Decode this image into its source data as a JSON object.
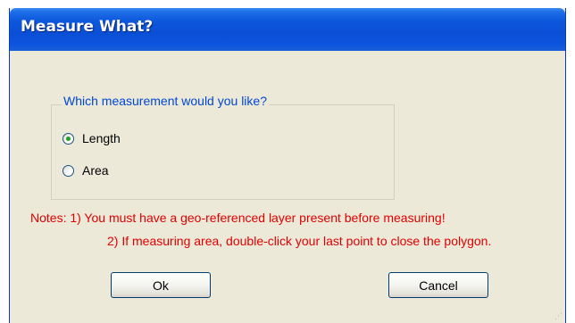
{
  "dialog": {
    "title": "Measure What?"
  },
  "group": {
    "legend": "Which measurement would you like?",
    "options": [
      {
        "label": "Length",
        "checked": true
      },
      {
        "label": "Area",
        "checked": false
      }
    ]
  },
  "notes": {
    "line1": "Notes: 1) You must have a geo-referenced layer present before measuring!",
    "line2": "2) If measuring area, double-click your last point to close the polygon."
  },
  "buttons": {
    "ok_label": "Ok",
    "cancel_label": "Cancel"
  },
  "colors": {
    "title_bar": "#0a4fd6",
    "window_bg": "#ece9d8",
    "legend_text": "#0046d5",
    "notes_text": "#e00000",
    "radio_checked_dot": "#21a121"
  }
}
